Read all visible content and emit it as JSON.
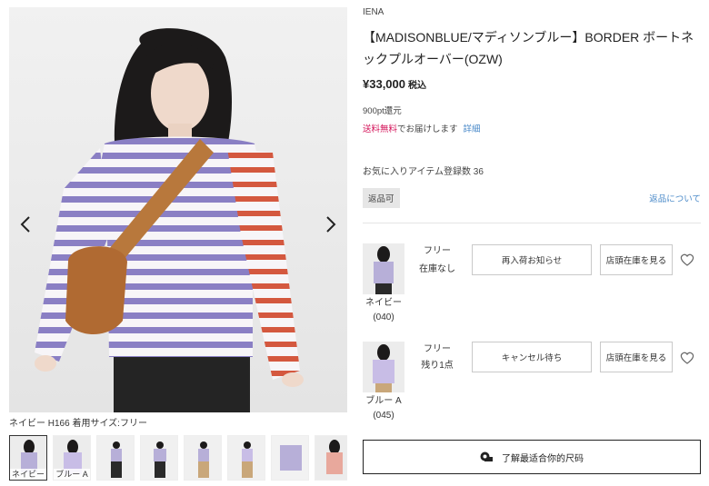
{
  "gallery": {
    "caption": "ネイビー H166 着用サイズ:フリー",
    "thumbnails": [
      {
        "label": "ネイビー",
        "active": true
      },
      {
        "label": "ブルー A",
        "active": false
      },
      {
        "label": "",
        "active": false
      },
      {
        "label": "",
        "active": false
      },
      {
        "label": "",
        "active": false
      },
      {
        "label": "",
        "active": false
      },
      {
        "label": "",
        "active": false
      },
      {
        "label": "",
        "active": false
      }
    ]
  },
  "product": {
    "brand": "IENA",
    "title": "【MADISONBLUE/マディソンブルー】BORDER ボートネックプルオーバー(OZW)",
    "price": "¥33,000",
    "tax_label": "税込",
    "points": "900pt還元",
    "shipping_free": "送料無料",
    "shipping_text": "でお届けします",
    "shipping_link": "詳細",
    "favorites": "お気に入りアイテム登録数 36",
    "returns_badge": "返品可",
    "returns_link": "返品について"
  },
  "variants": [
    {
      "color": "ネイビー",
      "code": "(040)",
      "size": "フリー",
      "stock": "在庫なし",
      "action_label": "再入荷お知らせ",
      "store_label": "店頭在庫を見る"
    },
    {
      "color": "ブルー A",
      "code": "(045)",
      "size": "フリー",
      "stock": "残り1点",
      "action_label": "キャンセル待ち",
      "store_label": "店頭在庫を見る"
    }
  ],
  "size_guide": {
    "label": "了解最适合你的尺码"
  },
  "colors": {
    "accent_link": "#4a8ac9",
    "free_shipping": "#d4145a",
    "stripe_purple": "#8a7fc4",
    "stripe_red": "#d4583f"
  }
}
